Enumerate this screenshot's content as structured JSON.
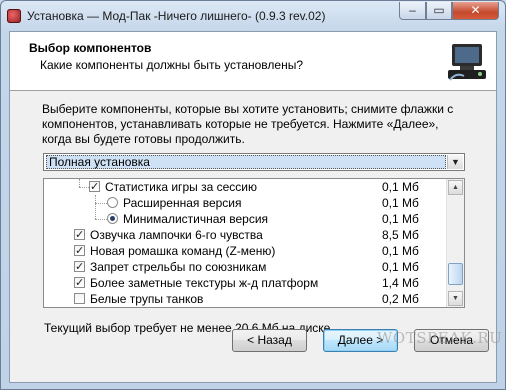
{
  "window": {
    "title": "Установка — Мод-Пак -Ничего лишнего- (0.9.3 rev.02)",
    "min_label": "‒",
    "max_label": "▭",
    "close_label": "✕"
  },
  "header": {
    "title": "Выбор компонентов",
    "subtitle": "Какие компоненты должны быть установлены?",
    "image_icon": "installer-computer-icon"
  },
  "description": "Выберите компоненты, которые вы хотите установить; снимите флажки с компонентов, устанавливать которые не требуется. Нажмите «Далее», когда вы будете готовы продолжить.",
  "install_type": {
    "selected": "Полная установка",
    "arrow": "▼"
  },
  "components": [
    {
      "label": "Статистика игры за сессию",
      "size": "0,1 Мб",
      "control": "checkbox",
      "checked": true
    },
    {
      "label": "Расширенная версия",
      "size": "0,1 Мб",
      "control": "radio",
      "checked": false
    },
    {
      "label": "Минималистичная версия",
      "size": "0,1 Мб",
      "control": "radio",
      "checked": true
    },
    {
      "label": "Озвучка лампочки 6-го чувства",
      "size": "8,5 Мб",
      "control": "checkbox",
      "checked": true
    },
    {
      "label": "Новая ромашка команд (Z-меню)",
      "size": "0,1 Мб",
      "control": "checkbox",
      "checked": true
    },
    {
      "label": "Запрет стрельбы по союзникам",
      "size": "0,1 Мб",
      "control": "checkbox",
      "checked": true
    },
    {
      "label": "Более заметные текстуры ж-д платформ",
      "size": "1,4 Мб",
      "control": "checkbox",
      "checked": true
    },
    {
      "label": "Белые трупы танков",
      "size": "0,2 Мб",
      "control": "checkbox",
      "checked": false
    }
  ],
  "scroll": {
    "up": "▲",
    "down": "▼",
    "position": 0.8
  },
  "space_required": "Текущий выбор требует не менее 20,6 Мб на диске.",
  "buttons": {
    "back": "< Назад",
    "next": "Далее >",
    "cancel": "Отмена"
  },
  "watermark": "WOTSPEAK.RU"
}
